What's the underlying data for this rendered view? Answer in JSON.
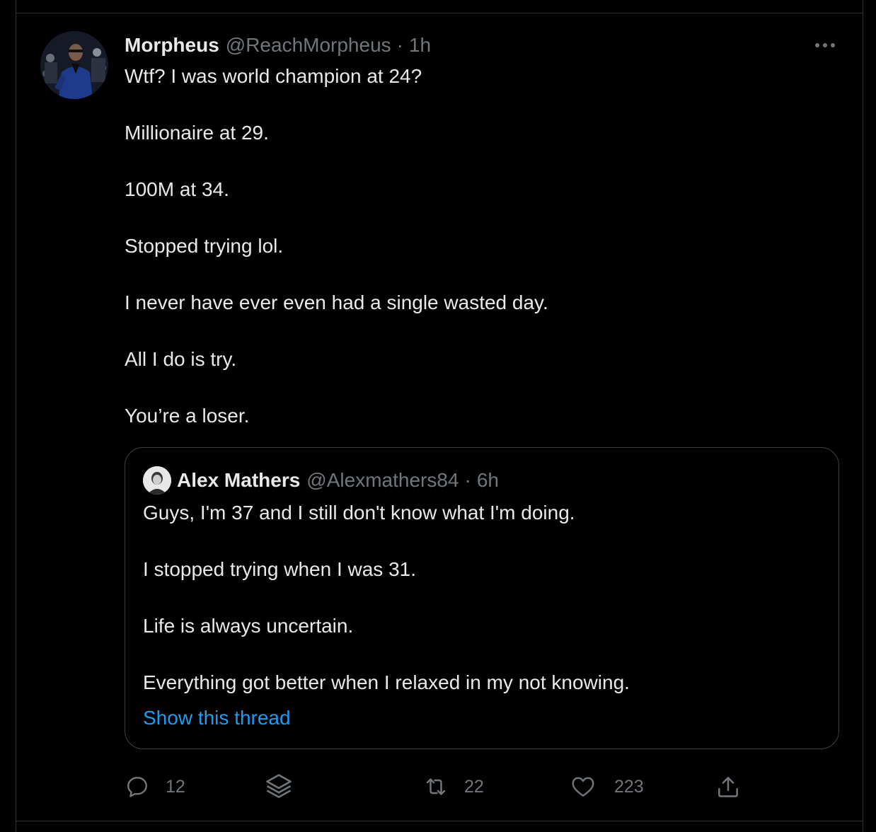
{
  "tweet": {
    "author_name": "Morpheus",
    "author_handle": "@ReachMorpheus",
    "separator": "·",
    "time": "1h",
    "text_lines": [
      "Wtf? I was world champion at 24?",
      "Millionaire at 29.",
      "100M at 34.",
      "Stopped trying lol.",
      "I never have ever even had a single wasted day.",
      "All I do is try.",
      "You’re a loser."
    ],
    "avatar_icon": "profile-photo",
    "more_icon": "more-horizontal-icon"
  },
  "quote": {
    "author_name": "Alex Mathers",
    "author_handle": "@Alexmathers84",
    "separator": "·",
    "time": "6h",
    "text_lines": [
      "Guys, I'm 37 and I still don't know what I'm doing.",
      "I stopped trying when I was 31.",
      "Life is always uncertain.",
      "Everything got better when I relaxed in my not knowing."
    ],
    "show_thread_label": "Show this thread",
    "link_color": "#1d9bf0"
  },
  "actions": {
    "reply_count": "12",
    "retweet_count": "22",
    "like_count": "223",
    "icons": [
      "reply-icon",
      "stack-icon",
      "retweet-icon",
      "like-icon",
      "share-icon"
    ]
  },
  "colors": {
    "background": "#000000",
    "text": "#e7e9ea",
    "secondary": "#71767b",
    "border": "#2f3336"
  }
}
